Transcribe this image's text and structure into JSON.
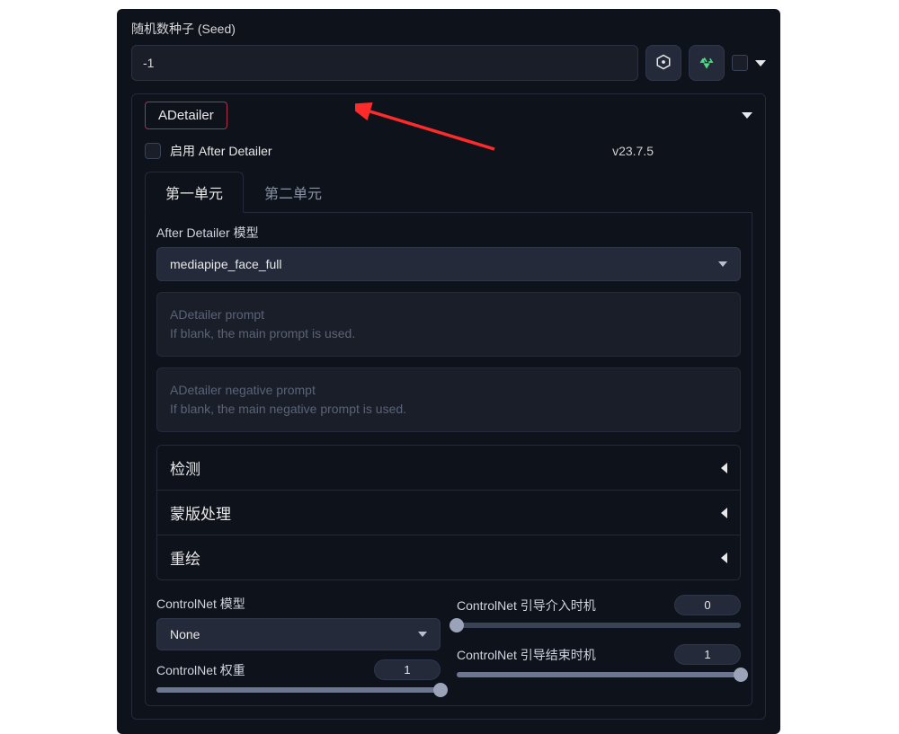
{
  "seed": {
    "label": "随机数种子 (Seed)",
    "value": "-1"
  },
  "adetailer": {
    "tag": "ADetailer",
    "enable_label": "启用 After Detailer",
    "version": "v23.7.5",
    "tabs": [
      "第一单元",
      "第二单元"
    ],
    "active_tab": 0,
    "model_label": "After Detailer 模型",
    "model_value": "mediapipe_face_full",
    "prompt_placeholder": "ADetailer prompt",
    "prompt_placeholder_sub": "If blank, the main prompt is used.",
    "neg_prompt_placeholder": "ADetailer negative prompt",
    "neg_prompt_placeholder_sub": "If blank, the main negative prompt is used.",
    "accordions": [
      "检测",
      "蒙版处理",
      "重绘"
    ],
    "controlnet": {
      "model_label": "ControlNet 模型",
      "model_value": "None",
      "weight_label": "ControlNet 权重",
      "weight_value": 1,
      "guidance_start_label": "ControlNet 引导介入时机",
      "guidance_start_value": 0,
      "guidance_end_label": "ControlNet 引导结束时机",
      "guidance_end_value": 1
    }
  }
}
